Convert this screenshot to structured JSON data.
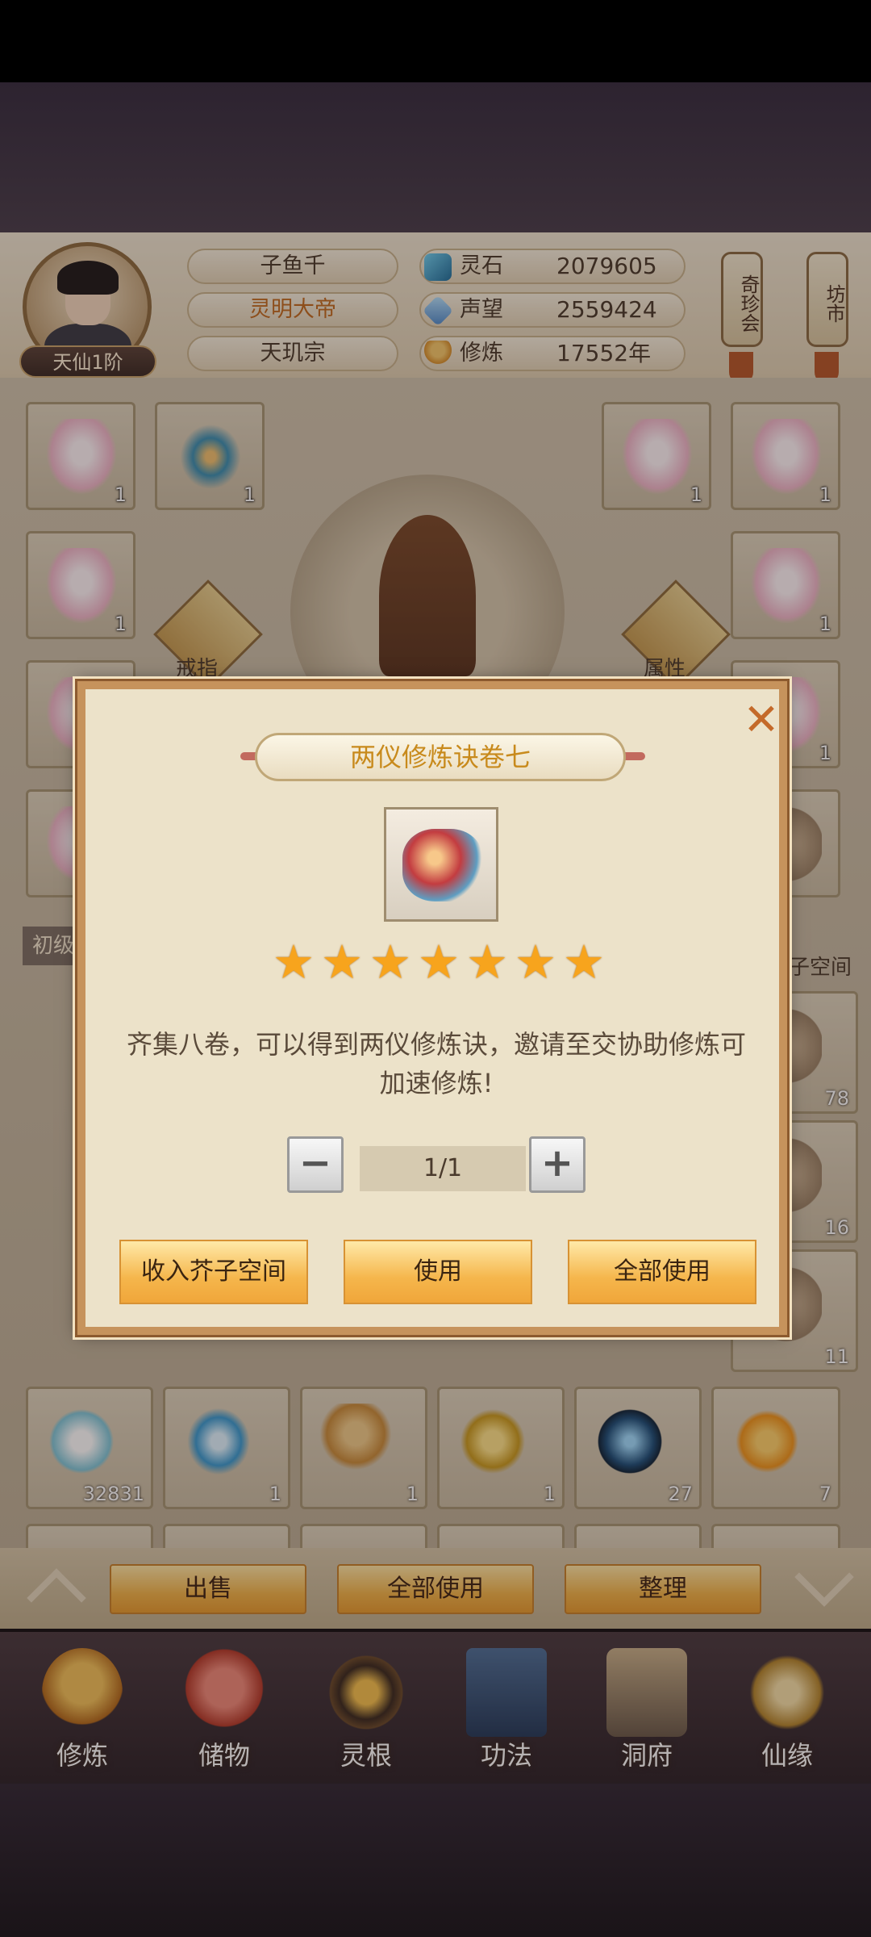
{
  "player": {
    "name": "子鱼千",
    "title": "灵明大帝",
    "sect": "天玑宗",
    "rank": "天仙1阶"
  },
  "stats": {
    "spirit_stones_label": "灵石",
    "spirit_stones_value": "2079605",
    "fame_label": "声望",
    "fame_value": "2559424",
    "cultivation_label": "修炼",
    "cultivation_value": "17552年"
  },
  "side_buttons": {
    "treasure": "奇珍会",
    "market": "坊市"
  },
  "equipment": {
    "ring_label": "戒指",
    "attr_label": "属性",
    "slots_left": [
      {
        "count": "1",
        "type": "robe"
      },
      {
        "count": "1",
        "type": "bow"
      },
      {
        "count": "1",
        "type": "robe"
      }
    ],
    "slots_right": [
      {
        "count": "1",
        "type": "robe"
      },
      {
        "count": "1",
        "type": "robe"
      },
      {
        "count": "1",
        "type": "robe"
      },
      {
        "count": "1",
        "type": "robe"
      }
    ]
  },
  "tabs": {
    "beginner": "初级",
    "space": "子空间"
  },
  "inventory": {
    "visible_counts_right": [
      "78",
      "16",
      "11"
    ],
    "row_bottom": [
      "32831",
      "1",
      "1",
      "1",
      "27",
      "7"
    ]
  },
  "action_bar": {
    "sell": "出售",
    "use_all": "全部使用",
    "sort": "整理"
  },
  "nav": [
    "修炼",
    "储物",
    "灵根",
    "功法",
    "洞府",
    "仙缘"
  ],
  "dialog": {
    "title": "两仪修炼诀卷七",
    "close": "✕",
    "stars": 7,
    "description": "齐集八卷，可以得到两仪修炼诀，邀请至交协助修炼可加速修炼!",
    "quantity": "1/1",
    "minus": "−",
    "plus": "+",
    "btn_store": "收入芥子空间",
    "btn_use": "使用",
    "btn_use_all": "全部使用"
  },
  "colors": {
    "accent_gold": "#f2b449",
    "title_orange": "#c26a1f",
    "dialog_bg": "#ece2c9",
    "star": "#f7a41d"
  }
}
